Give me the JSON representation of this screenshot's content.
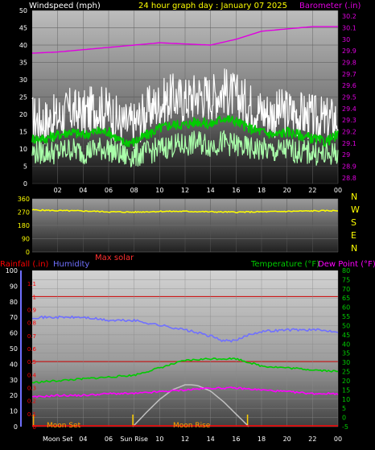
{
  "header": {
    "left_title": "Windspeed (mph)",
    "center_title": "24 hour graph day : January 07 2025",
    "right_title": "Barometer (.in)"
  },
  "colors": {
    "background": "#000000",
    "windspeed_title": "#ffffff",
    "center_title": "#ffff00",
    "barometer": "#e000e0",
    "wind_gust": "#ffffff",
    "wind_avg": "#00cc00",
    "wind_speed": "#aaffaa",
    "direction": "#ffff00",
    "compass": "#ffff00",
    "rainfall": "#ff0000",
    "humidity": "#7070ff",
    "max_solar": "#ff3030",
    "temperature": "#00cc00",
    "dew_point": "#ff00ff",
    "solar_curve": "#c0c0c0",
    "moon": "#ffa500"
  },
  "compass": {
    "labels": [
      "N",
      "W",
      "S",
      "E",
      "N"
    ]
  },
  "bottom_header": {
    "rainfall_label": "Rainfall (.in)",
    "humidity_label": "Humidity",
    "max_solar_label": "Max solar",
    "temperature_label": "Temperature (°F)",
    "dew_point_label": "Dew Point (°F)"
  },
  "events": {
    "moon_set": "Moon Set",
    "moon_rise": "Moon Rise",
    "sun_rise": "Sun Rise"
  },
  "x_axis": {
    "top_ticks": [
      "02",
      "04",
      "06",
      "08",
      "10",
      "12",
      "14",
      "16",
      "18",
      "20",
      "22",
      "00"
    ],
    "bottom_ticks": [
      "Moon Set",
      "04",
      "06",
      "Sun Rise",
      "10",
      "12",
      "14",
      "16",
      "18",
      "20",
      "22",
      "00"
    ]
  },
  "chart_data": [
    {
      "type": "line",
      "title": "Windspeed (mph)",
      "secondary_title": "Barometer (.in)",
      "x_range_hours": [
        0,
        24
      ],
      "y_left": {
        "label": "Windspeed (mph)",
        "range": [
          0,
          50
        ],
        "ticks": [
          "0",
          "5",
          "10",
          "15",
          "20",
          "25",
          "30",
          "35",
          "40",
          "45",
          "50"
        ]
      },
      "y_right": {
        "label": "Barometer (.in)",
        "range": [
          28.75,
          30.25
        ],
        "ticks": [
          "28.8",
          "28.9",
          "29",
          "29.1",
          "29.2",
          "29.3",
          "29.4",
          "29.5",
          "29.6",
          "29.7",
          "29.8",
          "29.9",
          "30",
          "30.1",
          "30.2"
        ]
      },
      "series": [
        {
          "name": "Barometer (.in)",
          "axis": "right",
          "x": [
            0,
            2,
            4,
            6,
            8,
            10,
            12,
            14,
            16,
            18,
            20,
            22,
            24
          ],
          "y": [
            29.88,
            29.89,
            29.91,
            29.93,
            29.95,
            29.97,
            29.96,
            29.95,
            30.0,
            30.07,
            30.09,
            30.11,
            30.11
          ]
        },
        {
          "axis": "left",
          "style": "gust",
          "x": [
            0,
            1,
            2,
            3,
            4,
            5,
            6,
            7,
            8,
            9,
            10,
            11,
            12,
            13,
            14,
            15,
            16,
            17,
            18,
            19,
            20,
            21,
            22,
            23,
            24
          ],
          "y": [
            19,
            18,
            19,
            21,
            20,
            22,
            21,
            17,
            17,
            21,
            23,
            25,
            24,
            26,
            25,
            27,
            25,
            23,
            21,
            20,
            21,
            20,
            19,
            18,
            19
          ]
        },
        {
          "axis": "left",
          "style": "avg",
          "x": [
            0,
            1,
            2,
            3,
            4,
            5,
            6,
            7,
            8,
            9,
            10,
            11,
            12,
            13,
            14,
            15,
            16,
            17,
            18,
            19,
            20,
            21,
            22,
            23,
            24
          ],
          "y": [
            13,
            13,
            14,
            15,
            14,
            15,
            15,
            12,
            12,
            14,
            16,
            17,
            17,
            18,
            17,
            19,
            18,
            16,
            15,
            14,
            15,
            14,
            13,
            12,
            14
          ]
        },
        {
          "axis": "left",
          "style": "speed",
          "x": [
            0,
            1,
            2,
            3,
            4,
            5,
            6,
            7,
            8,
            9,
            10,
            11,
            12,
            13,
            14,
            15,
            16,
            17,
            18,
            19,
            20,
            21,
            22,
            23,
            24
          ],
          "y": [
            9,
            9,
            9,
            10,
            9,
            10,
            10,
            8,
            8,
            9,
            10,
            11,
            11,
            12,
            11,
            12,
            11,
            10,
            10,
            9,
            10,
            9,
            9,
            8,
            9
          ]
        }
      ]
    },
    {
      "type": "line",
      "x_range_hours": [
        0,
        24
      ],
      "y_left": {
        "range": [
          0,
          360
        ],
        "ticks": [
          "0",
          "90",
          "180",
          "270",
          "360"
        ]
      },
      "series": [
        {
          "axis": "left",
          "x": [
            0,
            2,
            4,
            6,
            8,
            10,
            12,
            14,
            16,
            18,
            20,
            22,
            24
          ],
          "y": [
            285,
            280,
            278,
            272,
            270,
            275,
            275,
            272,
            270,
            272,
            275,
            278,
            280
          ]
        }
      ]
    },
    {
      "type": "line",
      "x_range_hours": [
        0,
        24
      ],
      "y_left_outer": {
        "label": "Humidity",
        "range": [
          0,
          100
        ],
        "ticks": [
          "0",
          "10",
          "20",
          "30",
          "40",
          "50",
          "60",
          "70",
          "80",
          "90",
          "100"
        ]
      },
      "y_left_inner": {
        "label": "Rainfall (.in)",
        "range": [
          0,
          1.2
        ],
        "ticks": [
          "0",
          "0.1",
          "0.2",
          "0.3",
          "0.4",
          "0.5",
          "0.6",
          "0.7",
          "0.8",
          "0.9",
          "1",
          "1.1"
        ]
      },
      "y_right": {
        "label": "Temperature (°F)",
        "range": [
          -5,
          80
        ],
        "ticks": [
          "-5",
          "0",
          "5",
          "10",
          "15",
          "20",
          "25",
          "30",
          "35",
          "40",
          "45",
          "50",
          "55",
          "60",
          "65",
          "70",
          "75",
          "80"
        ]
      },
      "series": [
        {
          "name": "Humidity",
          "axis": "left_outer",
          "x": [
            0,
            2,
            4,
            6,
            8,
            10,
            12,
            14,
            15,
            16,
            17,
            18,
            20,
            22,
            24
          ],
          "y": [
            70,
            70,
            70,
            68,
            68,
            65,
            62,
            58,
            55,
            55,
            59,
            61,
            62,
            62,
            61
          ]
        },
        {
          "name": "Temperature (°F)",
          "axis": "right",
          "x": [
            0,
            2,
            4,
            6,
            8,
            10,
            12,
            14,
            16,
            17,
            18,
            20,
            22,
            24
          ],
          "y": [
            19,
            20,
            21,
            22,
            23,
            27,
            31,
            32,
            32,
            30,
            28,
            27,
            26,
            25
          ]
        },
        {
          "name": "Dew Point (°F)",
          "axis": "right",
          "x": [
            0,
            2,
            4,
            6,
            8,
            10,
            12,
            14,
            16,
            18,
            20,
            22,
            24
          ],
          "y": [
            11,
            12,
            12,
            13,
            13,
            14,
            15,
            16,
            16,
            15,
            14,
            13,
            13
          ]
        },
        {
          "name": "Max solar",
          "axis": "relative",
          "style": "bell",
          "x": [
            7.9,
            9,
            10,
            11,
            12,
            12.5,
            13,
            14,
            15,
            16,
            17
          ],
          "y": [
            0,
            0.35,
            0.65,
            0.88,
            1.0,
            1.0,
            0.98,
            0.85,
            0.6,
            0.3,
            0
          ]
        },
        {
          "name": "Rainfall (.in)",
          "axis": "left_inner",
          "x": [
            0,
            24
          ],
          "y": [
            0,
            0
          ]
        }
      ],
      "markers_hours": {
        "moon_set": 0.1,
        "sun_rise": 7.9,
        "sun_set": 16.9,
        "moon_rise": 10.5
      }
    }
  ]
}
